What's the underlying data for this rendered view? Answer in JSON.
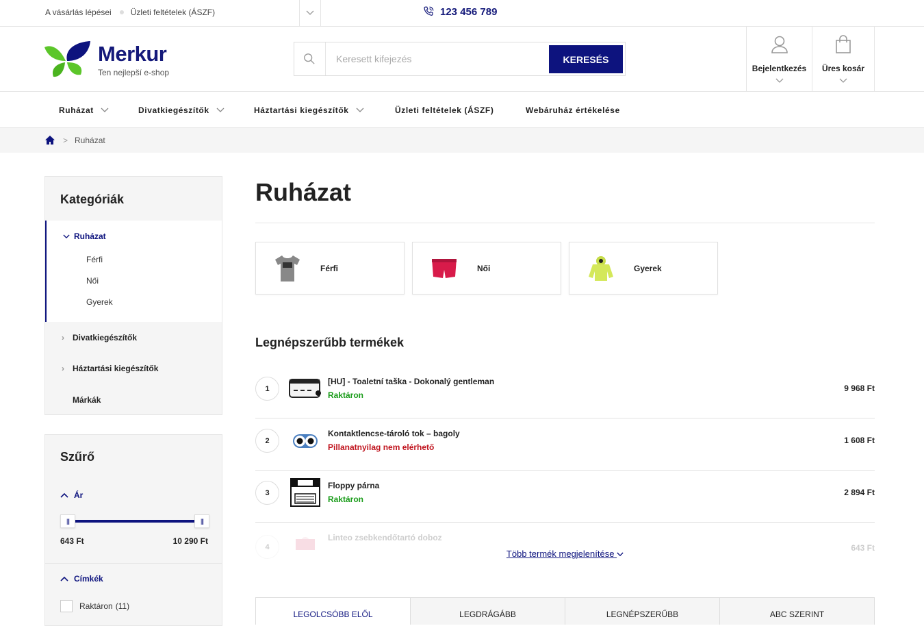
{
  "topbar": {
    "links": [
      "A vásárlás lépései",
      "Üzleti feltételek (ÁSZF)"
    ],
    "phone": "123 456 789"
  },
  "header": {
    "brand": "Merkur",
    "tagline": "Ten nejlepší e-shop",
    "search_placeholder": "Keresett kifejezés",
    "search_button": "KERESÉS",
    "login_label": "Bejelentkezés",
    "cart_label": "Üres kosár"
  },
  "nav": {
    "items": [
      "Ruházat",
      "Divatkiegészítők",
      "Háztartási kiegészítők",
      "Üzleti feltételek (ÁSZF)",
      "Webáruház értékelése"
    ]
  },
  "breadcrumb": {
    "current": "Ruházat"
  },
  "sidebar": {
    "categories_title": "Kategóriák",
    "active_category": "Ruházat",
    "subcategories": [
      "Férfi",
      "Női",
      "Gyerek"
    ],
    "other_categories": [
      "Divatkiegészítők",
      "Háztartási kiegészítők",
      "Márkák"
    ],
    "filter_title": "Szűrő",
    "price_label": "Ár",
    "price_min": "643 Ft",
    "price_max": "10 290 Ft",
    "price_range_fraction": [
      0,
      1
    ],
    "tags_label": "Címkék",
    "tag_option": "Raktáron",
    "tag_count": "(11)"
  },
  "main": {
    "title": "Ruházat",
    "subcategories": [
      "Férfi",
      "Női",
      "Gyerek"
    ],
    "popular_title": "Legnépszerűbb termékek",
    "products": [
      {
        "rank": "1",
        "name": "[HU] - Toaletní taška - Dokonalý gentleman",
        "status": "Raktáron",
        "status_color": "#1a9c1a",
        "price": "9 968 Ft"
      },
      {
        "rank": "2",
        "name": "Kontaktlencse-tároló tok – bagoly",
        "status": "Pillanatnyilag nem elérhető",
        "status_color": "#c0141e",
        "price": "1 608 Ft"
      },
      {
        "rank": "3",
        "name": "Floppy párna",
        "status": "Raktáron",
        "status_color": "#1a9c1a",
        "price": "2 894 Ft"
      },
      {
        "rank": "4",
        "name": "Linteo zsebkendőtartó doboz",
        "status": "",
        "status_color": "#1a9c1a",
        "price": "643 Ft"
      }
    ],
    "show_more": "Több termék megjelenítése",
    "sort_tabs": [
      "LEGOLCSÓBB ELŐL",
      "LEGDRÁGÁBB",
      "LEGNÉPSZERŰBB",
      "ABC SZERINT"
    ]
  }
}
